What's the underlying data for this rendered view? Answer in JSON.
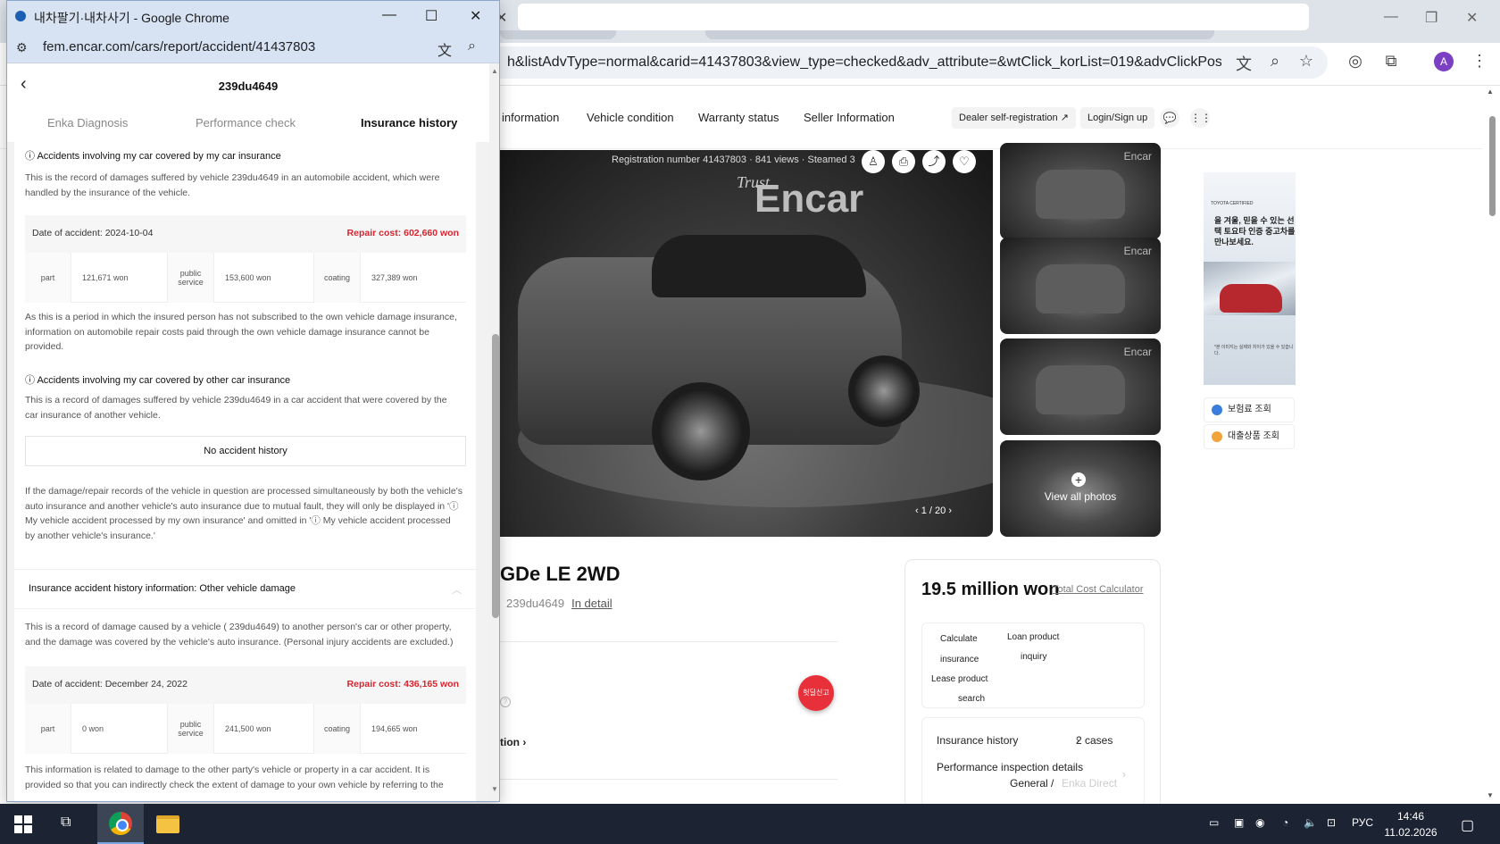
{
  "background": {
    "url": "h&listAdvType=normal&carid=41437803&view_type=checked&adv_attribute=&wtClick_korList=019&advClickPositio...",
    "avatar_letter": "A",
    "nav": [
      "information",
      "Vehicle condition",
      "Warranty status",
      "Seller Information"
    ],
    "dealer_btn": "Dealer self-registration ↗",
    "login_btn": "Login/Sign up",
    "photo": {
      "meta": "Registration number 41437803 · 841 views · Steamed 3",
      "brand": "Encar",
      "brand_small": "Trust",
      "pager": "1 / 20",
      "view_all": "View all photos",
      "thumb_mark": "Encar"
    },
    "ad": {
      "top": "TOYOTA CERTIFIED",
      "text": "올 겨울, 믿을 수 있는 선택 토요타 인증 중고차를 만나보세요.",
      "foot": "*본 이미지는 실제와 차이가 있을 수 있습니다."
    },
    "side_links": [
      "보험료 조회",
      "대출상품 조회"
    ],
    "car_title": "GDe LE 2WD",
    "car_plate": "239du4649",
    "in_detail": "In detail",
    "fragment": "tion",
    "fab_text": "헛딜신고",
    "price": {
      "value": "19.5 million won",
      "calc_link": "Total Cost Calculator",
      "options": {
        "calculate": "Calculate",
        "insurance": "insurance",
        "loan_product": "Loan product",
        "inquiry": "inquiry",
        "lease": "Lease product",
        "search": "search"
      },
      "insurance_history": "Insurance history",
      "insurance_cases": "2 cases",
      "perf_details": "Performance inspection details",
      "general": "General",
      "sep": "/",
      "enka_direct": "Enka Direct"
    }
  },
  "popup": {
    "title": "내차팔기·내차사기 - Google Chrome",
    "url": "fem.encar.com/cars/report/accident/41437803",
    "plate": "239du4649",
    "tabs": [
      "Enka Diagnosis",
      "Performance check",
      "Insurance history"
    ],
    "sec1": {
      "heading": "ⓘ Accidents involving my car covered by my car insurance",
      "desc": "This is the record of damages suffered by vehicle 239du4649 in an automobile accident, which were handled by the insurance of the vehicle.",
      "date": "Date of accident: 2024-10-04",
      "cost": "Repair cost: 602,660 won",
      "part_label": "part",
      "part_value": "121,671 won",
      "service_label": "public service",
      "service_value": "153,600 won",
      "coating_label": "coating",
      "coating_value": "327,389 won",
      "note": "As this is a period in which the insured person has not subscribed to the own vehicle damage insurance, information on automobile repair costs paid through the own vehicle damage insurance cannot be provided."
    },
    "sec2": {
      "heading": "ⓘ Accidents involving my car covered by other car insurance",
      "desc": "This is a record of damages suffered by vehicle 239du4649 in a car accident that were covered by the car insurance of another vehicle.",
      "no_accident": "No accident history",
      "note": "If the damage/repair records of the vehicle in question are processed simultaneously by both the vehicle's auto insurance and another vehicle's auto insurance due to mutual fault, they will only be displayed in 'ⓘ My vehicle accident processed by my own insurance' and omitted in 'ⓘ My vehicle accident processed by another vehicle's insurance.'"
    },
    "sec3": {
      "title": "Insurance accident history information: Other vehicle damage",
      "desc": "This is a record of damage caused by a vehicle ( 239du4649) to another person's car or other property, and the damage was covered by the vehicle's auto insurance. (Personal injury accidents are excluded.)",
      "date": "Date of accident: December 24, 2022",
      "cost": "Repair cost: 436,165 won",
      "part_label": "part",
      "part_value": "0 won",
      "service_label": "public service",
      "service_value": "241,500 won",
      "coating_label": "coating",
      "coating_value": "194,665 won",
      "note": "This information is related to damage to the other party's vehicle or property in a car accident. It is provided so that you can indirectly check the extent of damage to your own vehicle by referring to the"
    }
  },
  "taskbar": {
    "lang": "РУС",
    "time": "14:46",
    "date": "11.02.2026"
  }
}
